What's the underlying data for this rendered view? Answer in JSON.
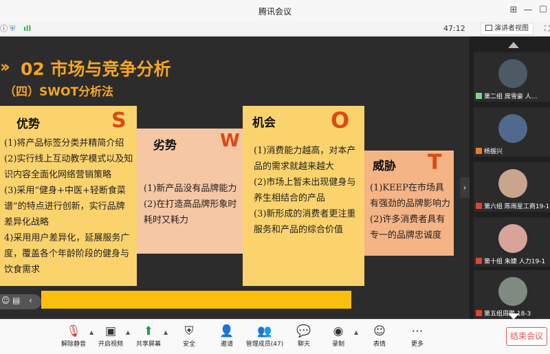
{
  "window": {
    "title": "腾讯会议"
  },
  "status": {
    "timer": "47:12",
    "view_label": "演讲者视图"
  },
  "slide": {
    "title": "02 市场与竞争分析",
    "subtitle": "（四）SWOT分析法",
    "cards": {
      "s": {
        "heading": "优势",
        "letter": "S",
        "lines": [
          "(1)将产品标签分类并精简介绍",
          "(2)实行线上互动教学模式以及知识内容全面化网络营销策略",
          "(3)采用“健身+中医+轻断食菜谱”的特点进行创新，实行品牌差异化战略",
          "4)采用用户差异化，延展服务广度，覆盖各个年龄阶段的健身与饮食需求"
        ]
      },
      "w": {
        "heading": "劣势",
        "letter": "W",
        "lines": [
          "(1)新产品没有品牌能力",
          "(2)在打造高品牌形象时耗时又耗力"
        ]
      },
      "o": {
        "heading": "机会",
        "letter": "O",
        "lines": [
          "(1)消费能力越高，对本产品的需求就越来越大",
          "(2)市场上暂未出现健身与养生相结合的产品",
          "(3)新形成的消费者更注重服务和产品的综合价值"
        ]
      },
      "t": {
        "heading": "威胁",
        "letter": "T",
        "lines": [
          "(1)KEEP在市场具有强劲的品牌影响力",
          "(2)许多消费者具有专一的品牌忠诚度"
        ]
      }
    }
  },
  "participants": [
    {
      "name": "第二组 席雪豪 人...",
      "avatar_color": "#4d5a66"
    },
    {
      "name": "杨振兴",
      "avatar_color": "#4f6a8c"
    },
    {
      "name": "第六组 陈雨星工商19-1",
      "avatar_color": "#c9a58e"
    },
    {
      "name": "第十组 朱婕 人力19-1",
      "avatar_color": "#d8a39a"
    },
    {
      "name": "第五组周鹏 18-3",
      "avatar_color": "#7f8a80"
    }
  ],
  "toolbar": {
    "unmute": "解除静音",
    "video": "开启视频",
    "share": "共享屏幕",
    "security": "安全",
    "invite": "邀请",
    "members": "管理成员(47)",
    "chat": "聊天",
    "record": "录制",
    "reactions": "表情",
    "more": "更多",
    "end": "结束会议"
  },
  "colors": {
    "accent": "#f5a623",
    "letter": "#d94b14",
    "end": "#e35454"
  }
}
